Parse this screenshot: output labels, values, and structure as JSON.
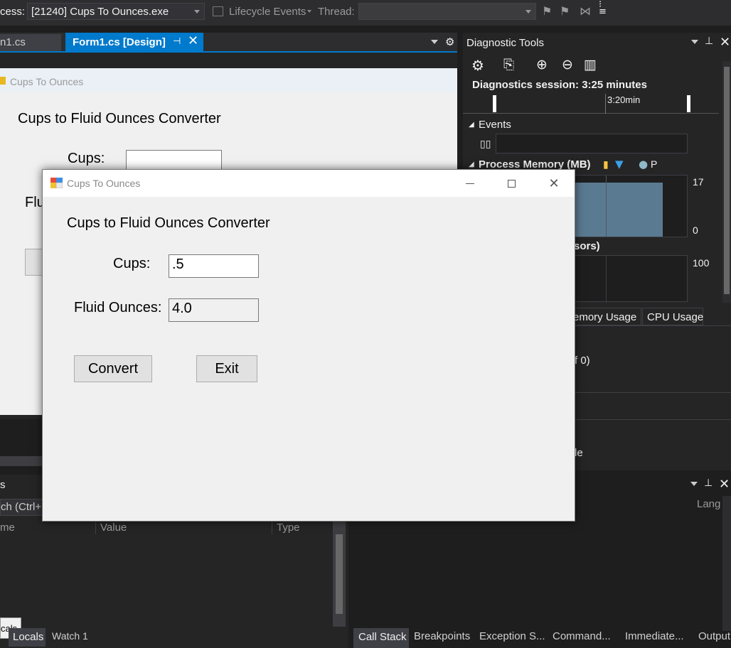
{
  "toolbar": {
    "process_label": "cess:",
    "process_value": "[21240] Cups To Ounces.exe",
    "lifecycle_label": "Lifecycle Events",
    "thread_label": "Thread:"
  },
  "doc_tabs": {
    "inactive": "n1.cs",
    "active": "Form1.cs [Design]"
  },
  "background_form": {
    "title": "Cups To Ounces",
    "heading": "Cups to Fluid Ounces Converter",
    "cups_label": "Cups:",
    "fluid_label_partial": "Flu"
  },
  "dialog": {
    "title": "Cups To Ounces",
    "heading": "Cups to Fluid Ounces Converter",
    "cups_label": "Cups:",
    "cups_value": ".5",
    "ounces_label": "Fluid Ounces:",
    "ounces_value": "4.0",
    "convert_label": "Convert",
    "exit_label": "Exit"
  },
  "diagnostic": {
    "title": "Diagnostic Tools",
    "session": "Diagnostics session: 3:25 minutes",
    "timeline_label": "3:20min",
    "events_label": "Events",
    "memory_label": "Process Memory (MB)",
    "memory_legend_p": "P",
    "memory_max": "17",
    "memory_min": "0",
    "cpu_partial": "sors)",
    "cpu_max": "100",
    "tab_memory": "emory Usage",
    "tab_cpu": "CPU Usage",
    "row_of0": "f 0)",
    "row_le": "le"
  },
  "locals": {
    "title_partial": "s",
    "search_partial": "ch (Ctrl+E",
    "col_name": "me",
    "col_value": "Value",
    "col_type": "Type",
    "tooltip": "cals",
    "tab_locals": "Locals",
    "tab_watch": "Watch 1"
  },
  "callstack": {
    "col_lang": "Lang",
    "tabs": [
      "Call Stack",
      "Breakpoints",
      "Exception S...",
      "Command...",
      "Immediate...",
      "Output"
    ]
  },
  "colors": {
    "accent": "#007acc",
    "vs_dark": "#1e1e1e",
    "form_bg": "#f0f0f0"
  }
}
